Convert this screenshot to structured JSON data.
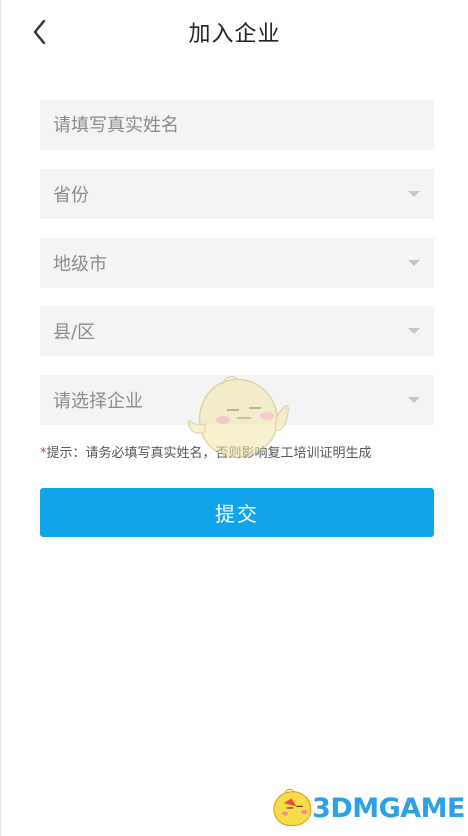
{
  "header": {
    "title": "加入企业"
  },
  "form": {
    "name_placeholder": "请填写真实姓名",
    "province_label": "省份",
    "city_label": "地级市",
    "county_label": "县/区",
    "company_label": "请选择企业",
    "hint_star": "*",
    "hint_text": "提示：请务必填写真实姓名，否则影响复工培训证明生成",
    "submit_label": "提交"
  },
  "watermark": {
    "logo_text": "3DMGAME"
  },
  "colors": {
    "accent": "#11a4ea",
    "field_bg": "#f4f4f4",
    "hint_star": "#e23b3b",
    "logo": "#2ea0e6"
  },
  "icons": {
    "back": "chevron-left-icon",
    "dropdown": "caret-down-icon"
  }
}
